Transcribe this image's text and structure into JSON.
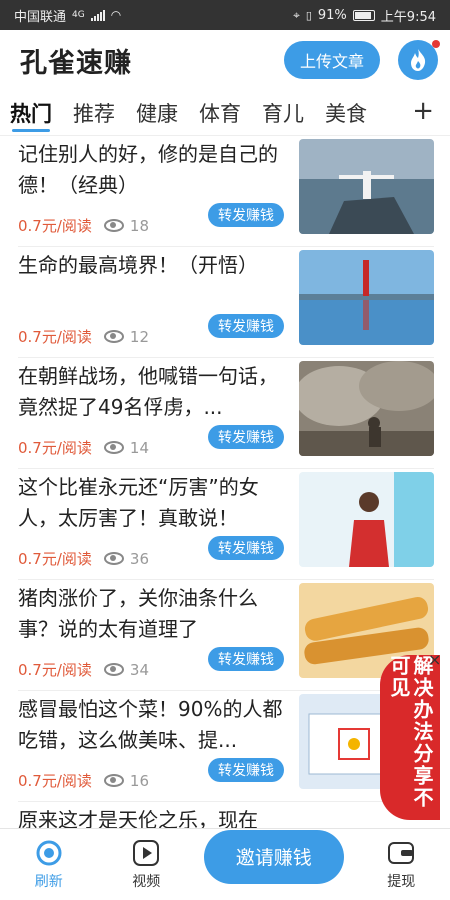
{
  "status_bar": {
    "carrier": "中国联通",
    "network": "4G",
    "battery": "91%",
    "time": "上午9:54"
  },
  "header": {
    "app_title": "孔雀速赚",
    "upload_label": "上传文章",
    "fire_icon": "fire-icon"
  },
  "tabs": [
    {
      "label": "热门",
      "active": true
    },
    {
      "label": "推荐",
      "active": false
    },
    {
      "label": "健康",
      "active": false
    },
    {
      "label": "体育",
      "active": false
    },
    {
      "label": "育儿",
      "active": false
    },
    {
      "label": "美食",
      "active": false
    }
  ],
  "tab_add": "+",
  "articles": [
    {
      "title": "记住别人的好，修的是自己的德！（经典）",
      "price": "0.7元/阅读",
      "views": "18",
      "share": "转发赚钱"
    },
    {
      "title": "生命的最高境界！（开悟）",
      "price": "0.7元/阅读",
      "views": "12",
      "share": "转发赚钱"
    },
    {
      "title": "在朝鲜战场，他喊错一句话，竟然捉了49名俘虏，...",
      "price": "0.7元/阅读",
      "views": "14",
      "share": "转发赚钱"
    },
    {
      "title": "这个比崔永元还“厉害”的女人，太厉害了！真敢说！",
      "price": "0.7元/阅读",
      "views": "36",
      "share": "转发赚钱"
    },
    {
      "title": "猪肉涨价了，关你油条什么事？说的太有道理了",
      "price": "0.7元/阅读",
      "views": "34",
      "share": "转发赚钱"
    },
    {
      "title": "感冒最怕这个菜！90%的人都吃错，这么做美味、提...",
      "price": "0.7元/阅读",
      "views": "16",
      "share": "转发赚钱"
    }
  ],
  "partial_article_title": "原来这才是天伦之乐，现在",
  "float_badge": {
    "text": "解决办法分享不可见",
    "close": "×"
  },
  "bottom_nav": {
    "refresh": "刷新",
    "video": "视频",
    "invite": "邀请赚钱",
    "withdraw": "提现"
  },
  "colors": {
    "accent": "#3d9ce6",
    "price": "#e05a3a",
    "badge": "#d9292a"
  }
}
